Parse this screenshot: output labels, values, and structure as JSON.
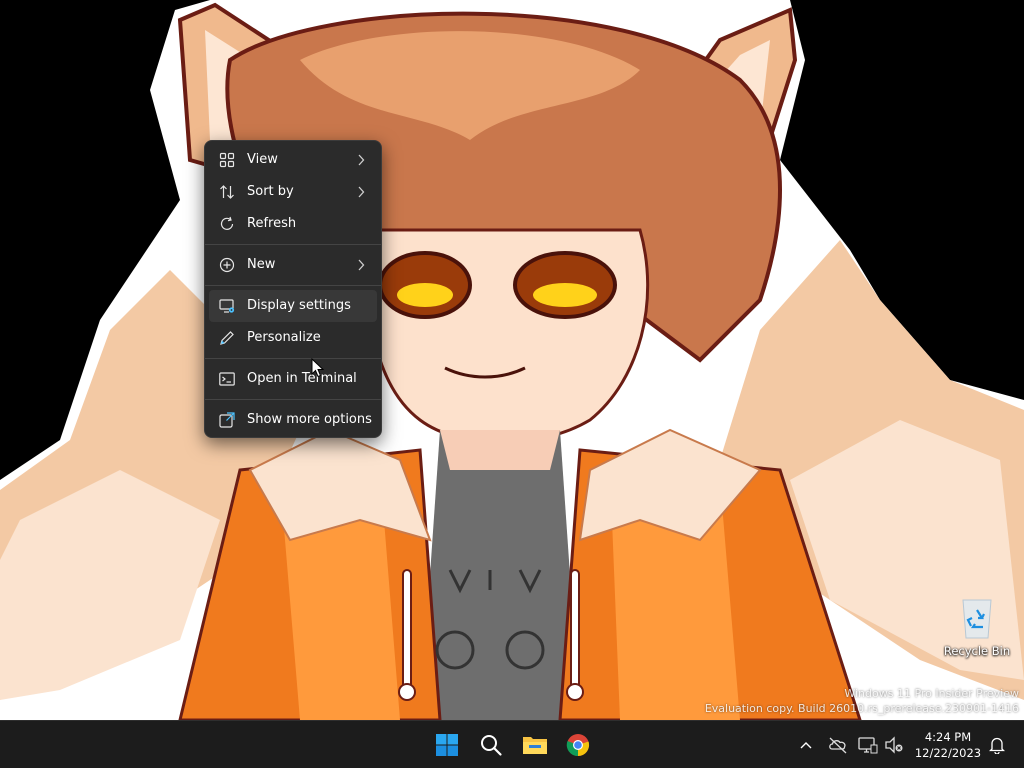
{
  "context_menu": {
    "items": [
      {
        "label": "View",
        "icon": "grid-view-icon",
        "submenu": true
      },
      {
        "label": "Sort by",
        "icon": "sort-arrows-icon",
        "submenu": true
      },
      {
        "label": "Refresh",
        "icon": "refresh-icon",
        "submenu": false
      },
      {
        "label": "New",
        "icon": "plus-circle-icon",
        "submenu": true
      },
      {
        "label": "Display settings",
        "icon": "display-settings-icon",
        "submenu": false
      },
      {
        "label": "Personalize",
        "icon": "pen-icon",
        "submenu": false
      },
      {
        "label": "Open in Terminal",
        "icon": "terminal-icon",
        "submenu": false
      },
      {
        "label": "Show more options",
        "icon": "show-more-icon",
        "submenu": false
      }
    ],
    "highlighted": "Display settings"
  },
  "desktop": {
    "recycle_bin_label": "Recycle Bin",
    "watermark_line1": "Windows 11 Pro Insider Preview",
    "watermark_line2": "Evaluation copy. Build 26010.rs_prerelease.230901-1416"
  },
  "taskbar": {
    "pinned": [
      "start-windows-icon",
      "search-icon",
      "file-explorer-icon",
      "chrome-icon"
    ],
    "tray_icons": [
      "chevron-up-icon",
      "network-off-icon",
      "monitor-icon",
      "volume-muted-icon",
      "notification-bell-icon"
    ],
    "clock_time": "4:24 PM",
    "clock_date": "12/22/2023"
  },
  "colors": {
    "menu_bg": "#2b2b2b",
    "menu_highlight": "#383838",
    "accent_blue": "#4cc2ff",
    "taskbar_bg": "#1c1c1c"
  }
}
